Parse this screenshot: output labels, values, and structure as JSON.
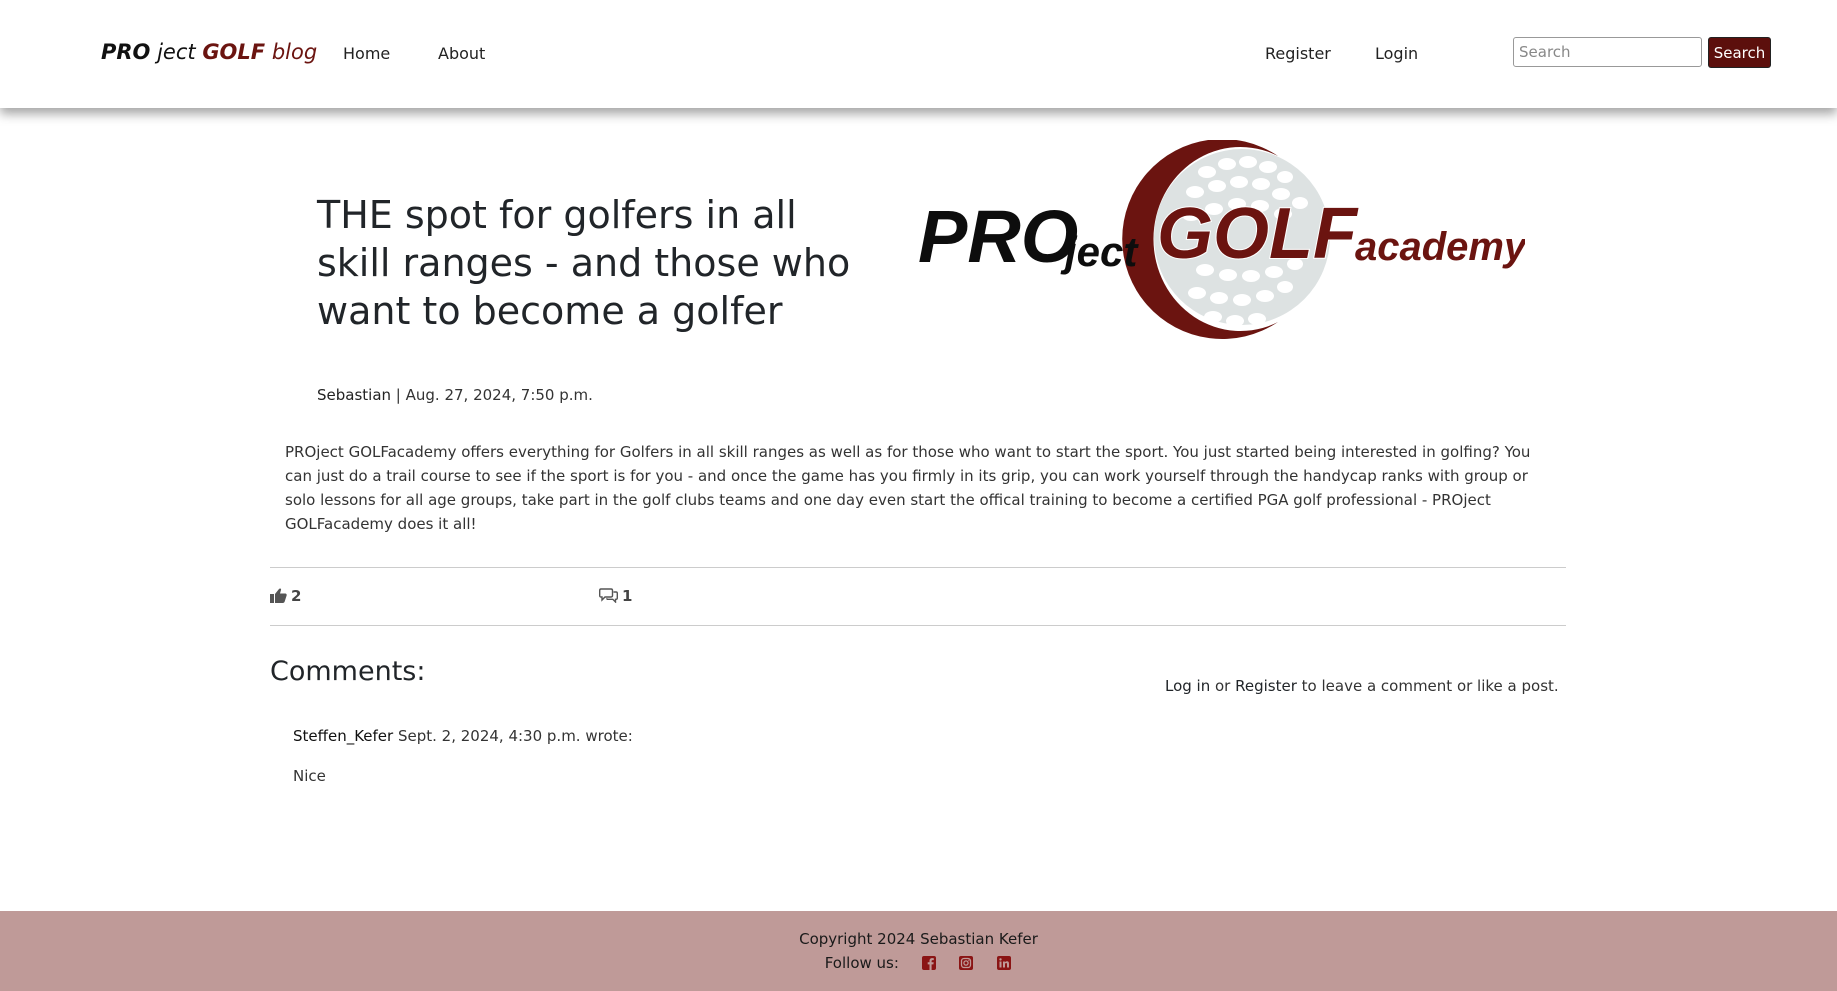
{
  "navbar": {
    "brand": {
      "part1": "PRO",
      "part2": " ject ",
      "part3": "GOLF",
      "part4": " blog"
    },
    "links": [
      "Home",
      "About"
    ],
    "auth_links": [
      "Register",
      "Login"
    ],
    "search": {
      "placeholder": "Search",
      "value": "",
      "button": "Search"
    }
  },
  "post": {
    "title": "THE spot for golfers in all skill ranges - and those who want to become a golfer",
    "logo": {
      "part1": "PRO",
      "part2": "ject",
      "part3": "GOLF",
      "part4": "academy"
    },
    "author": "Sebastian",
    "separator": " | ",
    "date": "Aug. 27, 2024, 7:50 p.m.",
    "excerpt": "PROject GOLFacademy offers everything for Golfers in all skill ranges as well as for those who want to start the sport. You just started being interested in golfing? You can just do a trail course to see if the sport is for you - and once the game has you firmly in its grip, you can work yourself through the handycap ranks with group or solo lessons for all age groups, take part in the golf clubs teams and one day even start the offical training to become a certified PGA golf professional - PROject GOLFacademy does it all!",
    "likes": "2",
    "comments_count": "1"
  },
  "comments": {
    "heading": "Comments:",
    "login_prompt": {
      "login": "Log in",
      "or": " or ",
      "register": "Register",
      "suffix": " to leave a comment or like a post."
    },
    "items": [
      {
        "author": "Steffen_Kefer",
        "date": " Sept. 2, 2024, 4:30 p.m. wrote:",
        "body": "Nice"
      }
    ]
  },
  "footer": {
    "copyright": "Copyright 2024 Sebastian Kefer",
    "follow": "Follow us:",
    "social_icons": [
      "facebook-icon",
      "instagram-icon",
      "linkedin-icon"
    ]
  },
  "colors": {
    "brand_red": "#6b1410",
    "button": "#5c0f0c",
    "footer_bg": "#bf9a98",
    "golfball": "#dde2e2"
  }
}
